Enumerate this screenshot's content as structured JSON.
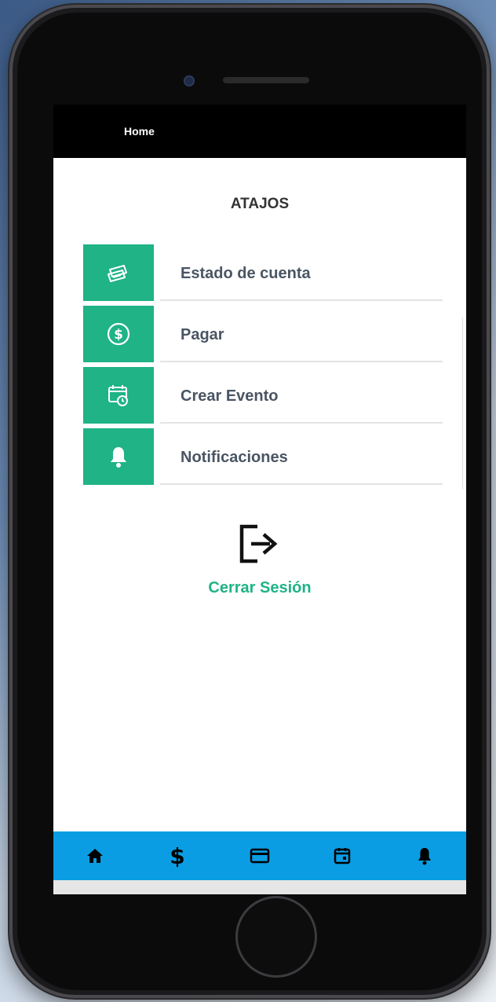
{
  "header": {
    "title": "Home"
  },
  "shortcuts": {
    "title": "ATAJOS",
    "items": [
      {
        "label": "Estado de cuenta",
        "icon": "money-cards-icon"
      },
      {
        "label": "Pagar",
        "icon": "dollar-circle-icon"
      },
      {
        "label": "Crear Evento",
        "icon": "calendar-clock-icon"
      },
      {
        "label": "Notificaciones",
        "icon": "bell-icon"
      }
    ]
  },
  "logout": {
    "label": "Cerrar Sesión",
    "icon": "logout-icon"
  },
  "bottom_nav": {
    "items": [
      {
        "icon": "home-icon",
        "active": true
      },
      {
        "icon": "dollar-icon"
      },
      {
        "icon": "card-icon"
      },
      {
        "icon": "calendar-icon"
      },
      {
        "icon": "bell-icon"
      }
    ]
  },
  "colors": {
    "accent": "#1fb386",
    "nav_bar": "#0a9de3",
    "top_bar": "#000000",
    "text": "#4a5563"
  }
}
